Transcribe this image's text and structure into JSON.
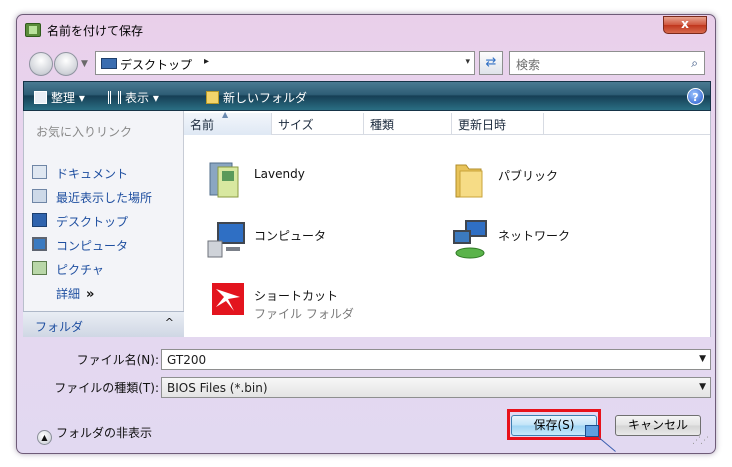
{
  "window": {
    "title": "名前を付けて保存",
    "close_glyph": "x"
  },
  "address_bar": {
    "location": "デスクトップ",
    "chevron": "▸",
    "dropdown": "▾"
  },
  "search": {
    "placeholder": "検索"
  },
  "toolbar": {
    "organize": "整理",
    "views": "表示",
    "new_folder": "新しいフォルダ",
    "help": "?"
  },
  "favorites": {
    "header": "お気に入りリンク",
    "items": [
      {
        "label": "ドキュメント",
        "icon": "documents-icon"
      },
      {
        "label": "最近表示した場所",
        "icon": "recent-places-icon"
      },
      {
        "label": "デスクトップ",
        "icon": "desktop-icon"
      },
      {
        "label": "コンピュータ",
        "icon": "computer-icon"
      },
      {
        "label": "ピクチャ",
        "icon": "pictures-icon"
      }
    ],
    "more_label": "詳細",
    "more_glyph": "»"
  },
  "folders_pane": {
    "label": "フォルダ",
    "chevron": "^"
  },
  "columns": [
    "名前",
    "サイズ",
    "種類",
    "更新日時"
  ],
  "items": [
    {
      "name": "Lavendy",
      "sub": "",
      "icon": "user-folder-icon"
    },
    {
      "name": "パブリック",
      "sub": "",
      "icon": "folder-icon"
    },
    {
      "name": "コンピュータ",
      "sub": "",
      "icon": "computer-icon"
    },
    {
      "name": "ネットワーク",
      "sub": "",
      "icon": "network-icon"
    },
    {
      "name": "ショートカット",
      "sub": "ファイル フォルダ",
      "icon": "shortcut-folder-icon"
    }
  ],
  "form": {
    "filename_label": "ファイル名(N):",
    "filename_value": "GT200",
    "filetype_label": "ファイルの種類(T):",
    "filetype_value": "BIOS Files (*.bin)",
    "hide_folders": "フォルダの非表示",
    "save_button": "保存(S)",
    "cancel_button": "キャンセル"
  },
  "colors": {
    "toolbar": "#2e5d75",
    "link": "#1f4fa0",
    "highlight": "#e8121b"
  }
}
